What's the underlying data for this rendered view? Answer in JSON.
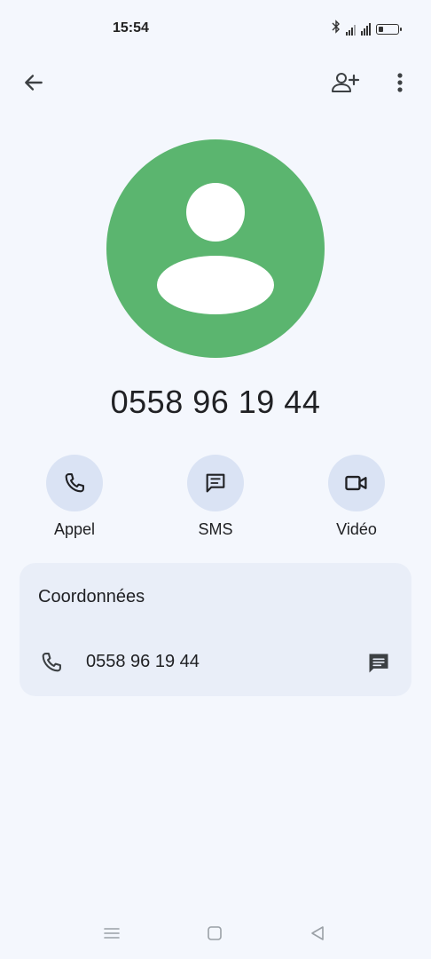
{
  "status_bar": {
    "time": "15:54",
    "icons": [
      "bluetooth-icon",
      "signal-icon",
      "wifi-icon",
      "battery-icon"
    ]
  },
  "top_bar": {
    "icons": [
      "back-arrow-icon",
      "add-contact-icon",
      "more-vert-icon"
    ]
  },
  "contact": {
    "name": "0558 96 19 44",
    "avatar_color": "#5bb56f"
  },
  "actions": [
    {
      "label": "Appel",
      "icon": "phone-icon"
    },
    {
      "label": "SMS",
      "icon": "message-icon"
    },
    {
      "label": "Vidéo",
      "icon": "videocam-icon"
    }
  ],
  "details": {
    "title": "Coordonnées",
    "phone": "0558 96 19 44",
    "icons": [
      "phone-icon",
      "message-icon"
    ]
  },
  "nav_bar": {
    "icons": [
      "menu-icon",
      "home-icon",
      "back-icon"
    ]
  },
  "colors": {
    "background": "#f4f7fd",
    "card": "#e9eef8",
    "action_circle": "#dae3f4"
  }
}
